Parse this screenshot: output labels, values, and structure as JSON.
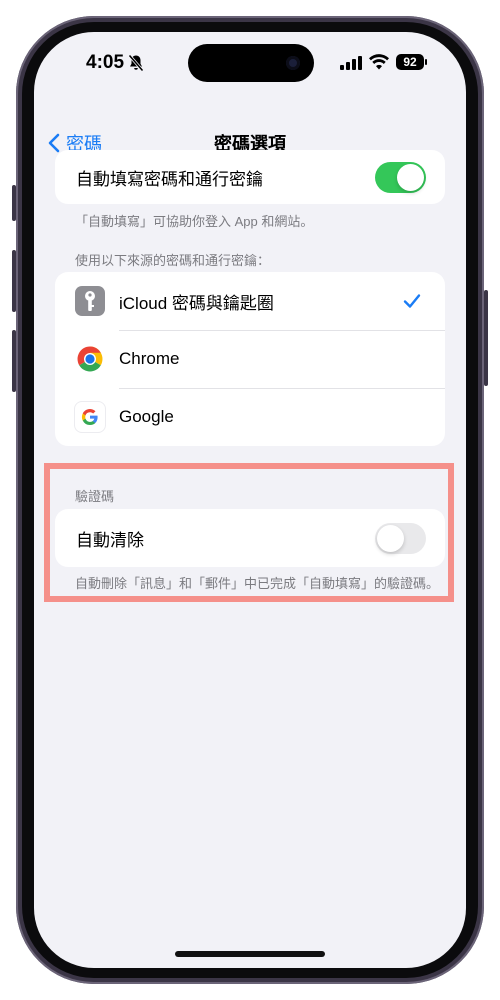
{
  "status_bar": {
    "time": "4:05",
    "battery": "92",
    "icons": [
      "bell-slash-icon",
      "signal-icon",
      "wifi-icon",
      "battery-icon"
    ]
  },
  "nav": {
    "back_label": "密碼",
    "title": "密碼選項"
  },
  "autofill": {
    "label": "自動填寫密碼和通行密鑰",
    "enabled": true,
    "footer": "「自動填寫」可協助你登入 App 和網站。"
  },
  "sources": {
    "header": "使用以下來源的密碼和通行密鑰：",
    "items": [
      {
        "label": "iCloud 密碼與鑰匙圈",
        "icon": "key-icon",
        "checked": true
      },
      {
        "label": "Chrome",
        "icon": "chrome-icon",
        "checked": false
      },
      {
        "label": "Google",
        "icon": "google-icon",
        "checked": false
      }
    ]
  },
  "verification": {
    "header": "驗證碼",
    "label": "自動清除",
    "enabled": false,
    "footer": "自動刪除「訊息」和「郵件」中已完成「自動填寫」的驗證碼。"
  },
  "colors": {
    "accent": "#1a7cf5",
    "toggle_on": "#34c759",
    "toggle_off": "#e9e9eb",
    "highlight": "#f5908a"
  }
}
